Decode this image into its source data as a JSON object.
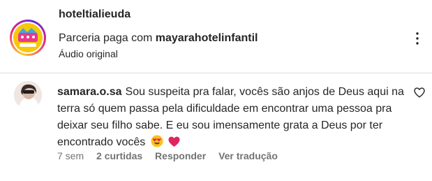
{
  "header": {
    "username": "hoteltialieuda",
    "partner_prefix": "Parceria paga com",
    "partner_name": "mayarahotelinfantil",
    "audio": "Áudio original",
    "logo_text": "Hotel da Tia Léu",
    "more_icon": "more-vertical-icon"
  },
  "comment": {
    "username": "samara.o.sa",
    "text": "Sou suspeita pra falar, vocês são anjos de Deus aqui na terra só quem passa pela dificuldade em encontrar uma pessoa pra deixar seu filho sabe. E eu sou imensamente grata a Deus por ter encontrado vocês",
    "emojis": [
      "😍",
      "❤️"
    ],
    "time": "7 sem",
    "likes": "2 curtidas",
    "reply": "Responder",
    "translate": "Ver tradução",
    "like_icon": "heart-outline-icon"
  },
  "colors": {
    "text": "#262626",
    "secondary": "#737373",
    "divider": "#dbdbdb",
    "logo_yellow": "#f6c80a"
  }
}
